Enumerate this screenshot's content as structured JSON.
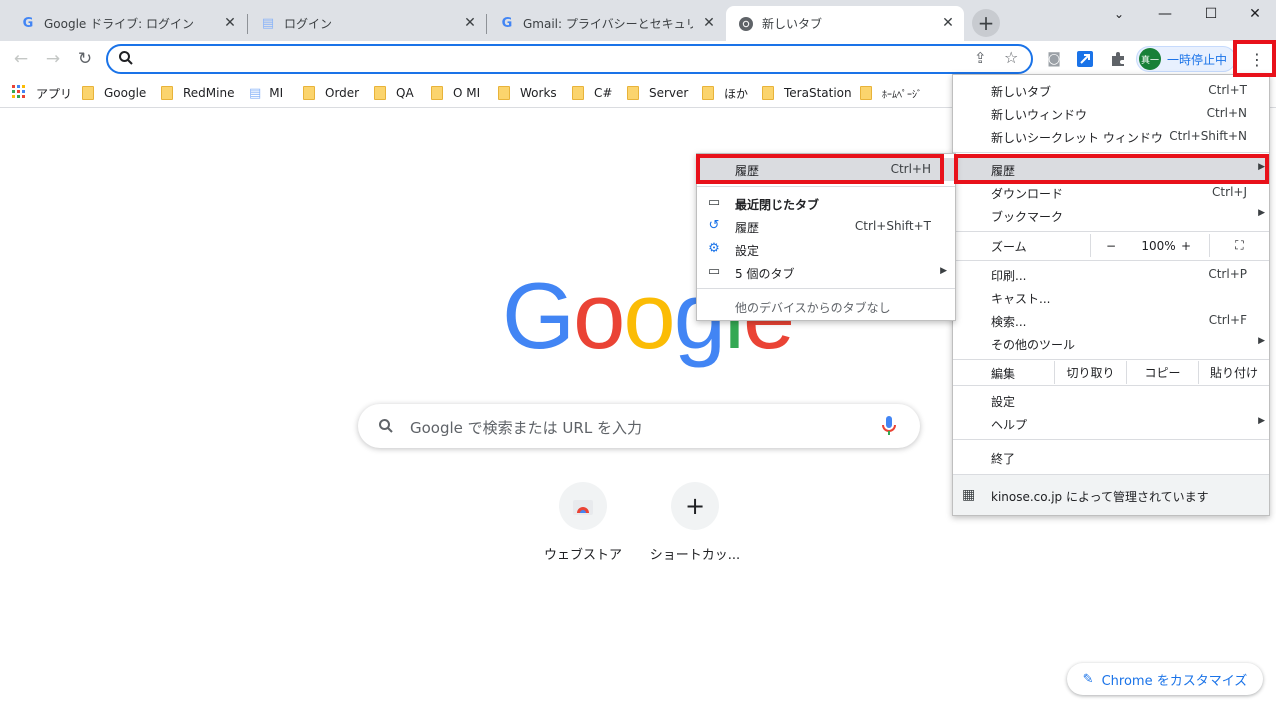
{
  "tabs": [
    {
      "title": "Google ドライブ: ログイン",
      "favicon": "google-g-icon"
    },
    {
      "title": "ログイン",
      "favicon": "document-icon"
    },
    {
      "title": "Gmail: プライバシーとセキュリティを保護",
      "favicon": "google-g-icon"
    },
    {
      "title": "新しいタブ",
      "favicon": "chrome-icon"
    }
  ],
  "toolbar": {
    "omnibox_value": "",
    "profile_avatar": "真一",
    "profile_label": "一時停止中"
  },
  "bookmarks": [
    {
      "label": "アプリ",
      "icon": "apps-grid-icon"
    },
    {
      "label": "Google",
      "icon": "folder-icon"
    },
    {
      "label": "RedMine",
      "icon": "folder-icon"
    },
    {
      "label": "MI",
      "icon": "document-icon"
    },
    {
      "label": "Order",
      "icon": "folder-icon"
    },
    {
      "label": "QA",
      "icon": "folder-icon"
    },
    {
      "label": "O MI",
      "icon": "folder-icon"
    },
    {
      "label": "Works",
      "icon": "folder-icon"
    },
    {
      "label": "C#",
      "icon": "folder-icon"
    },
    {
      "label": "Server",
      "icon": "folder-icon"
    },
    {
      "label": "ほか",
      "icon": "folder-icon"
    },
    {
      "label": "TeraStation",
      "icon": "folder-icon"
    },
    {
      "label": "ﾎｰﾑﾍﾟｰｼﾞ",
      "icon": "folder-icon"
    }
  ],
  "page": {
    "logo": [
      "G",
      "o",
      "o",
      "g",
      "l",
      "e"
    ],
    "search_placeholder": "Google で検索または URL を入力",
    "shortcuts": [
      {
        "label": "ウェブストア"
      },
      {
        "label": "ショートカッ..."
      }
    ],
    "customize_label": "Chrome をカスタマイズ"
  },
  "menu": {
    "new_tab": "新しいタブ",
    "new_tab_sc": "Ctrl+T",
    "new_window": "新しいウィンドウ",
    "new_window_sc": "Ctrl+N",
    "new_incognito": "新しいシークレット ウィンドウ",
    "new_incognito_sc": "Ctrl+Shift+N",
    "history": "履歴",
    "downloads": "ダウンロード",
    "downloads_sc": "Ctrl+J",
    "bookmarks": "ブックマーク",
    "zoom": "ズーム",
    "zoom_minus": "−",
    "zoom_value": "100%",
    "zoom_plus": "+",
    "print": "印刷...",
    "print_sc": "Ctrl+P",
    "cast": "キャスト...",
    "find": "検索...",
    "find_sc": "Ctrl+F",
    "more_tools": "その他のツール",
    "edit": "編集",
    "cut": "切り取り",
    "copy": "コピー",
    "paste": "貼り付け",
    "settings": "設定",
    "help": "ヘルプ",
    "exit": "終了",
    "managed": "kinose.co.jp によって管理されています"
  },
  "history_menu": {
    "history": "履歴",
    "history_sc": "Ctrl+H",
    "recently_closed": "最近閉じたタブ",
    "history2": "履歴",
    "history2_sc": "Ctrl+Shift+T",
    "settings": "設定",
    "tabs": "5 個のタブ",
    "no_other_devices": "他のデバイスからのタブなし"
  },
  "colors": {
    "accent": "#1a73e8",
    "highlight": "#e8111a"
  }
}
